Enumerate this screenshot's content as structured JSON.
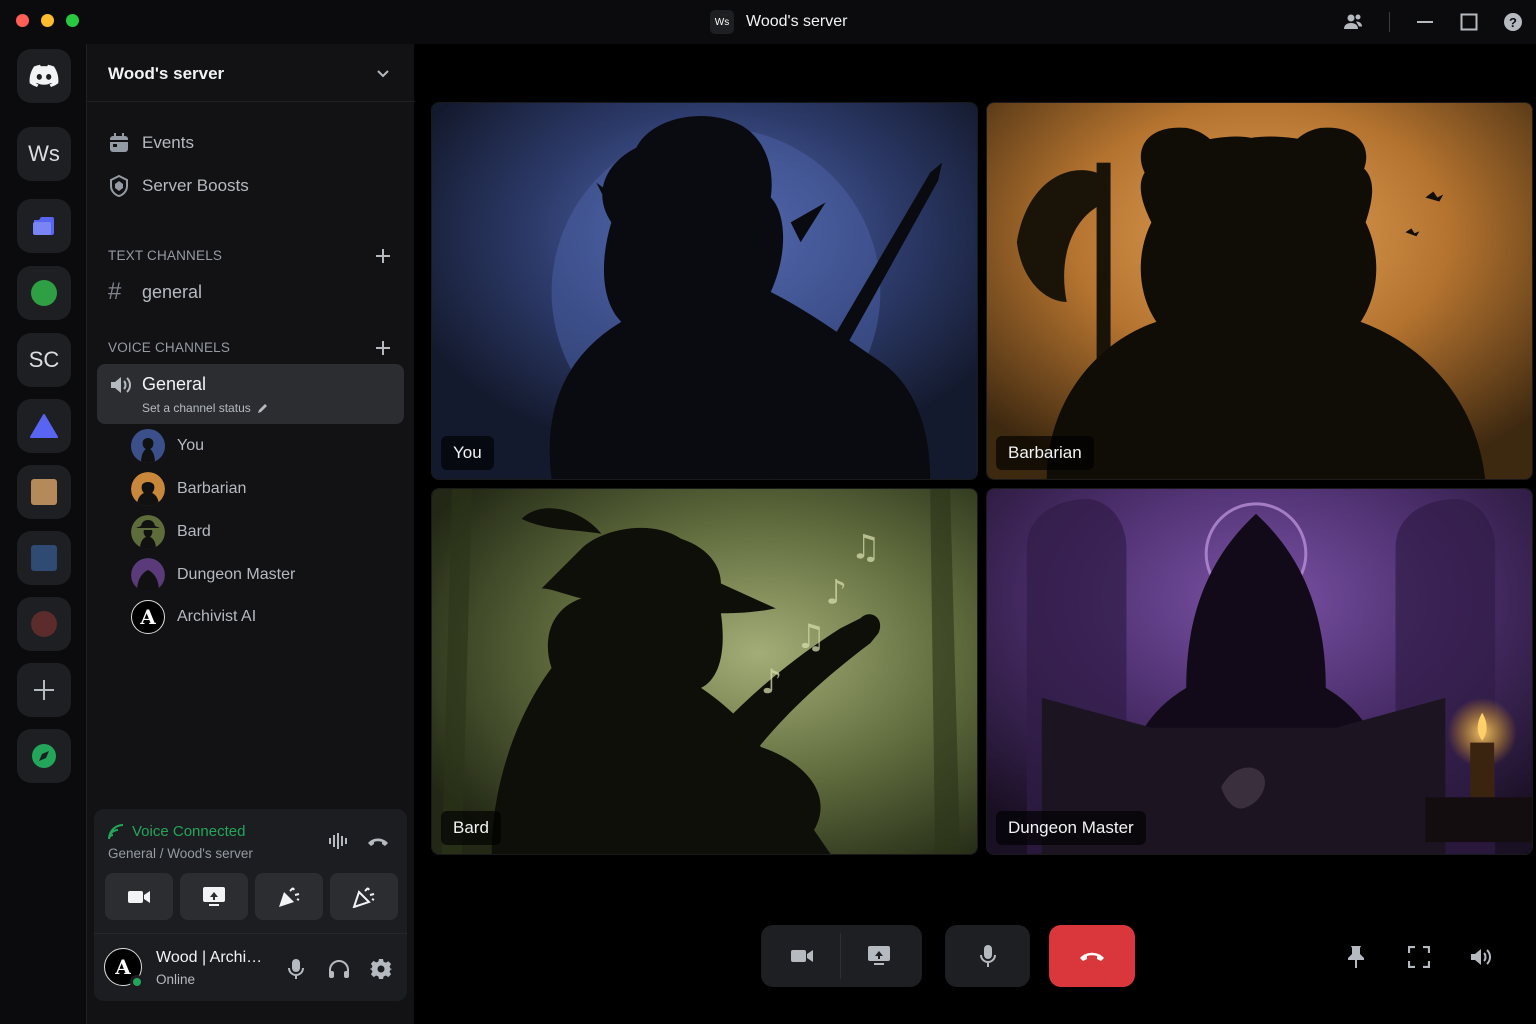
{
  "window": {
    "title": "Wood's server",
    "badge": "Ws"
  },
  "rail": {
    "servers": [
      {
        "kind": "home",
        "icon": "discord-logo-icon"
      },
      {
        "kind": "text",
        "label": "Ws"
      },
      {
        "kind": "color",
        "color": "#5865f2",
        "icon": "folder-icon"
      },
      {
        "kind": "color",
        "color": "#2ea043"
      },
      {
        "kind": "text",
        "label": "SC"
      },
      {
        "kind": "color",
        "color": "#5865f2",
        "icon": "triangle-icon"
      },
      {
        "kind": "color",
        "color": "#b58a5a"
      },
      {
        "kind": "color",
        "color": "#2f4a73"
      },
      {
        "kind": "color",
        "color": "#5c2b2b"
      },
      {
        "kind": "action",
        "icon": "add-server-icon"
      },
      {
        "kind": "action",
        "icon": "discover-compass-icon",
        "color": "#23a55a"
      }
    ]
  },
  "sidebar": {
    "server_name": "Wood's server",
    "menu": [
      {
        "label": "Events",
        "icon": "calendar-icon"
      },
      {
        "label": "Server Boosts",
        "icon": "boost-shield-icon"
      }
    ],
    "text_section": "TEXT CHANNELS",
    "text_channels": [
      {
        "label": "general"
      }
    ],
    "voice_section": "VOICE CHANNELS",
    "voice_channel": {
      "name": "General",
      "status_placeholder": "Set a channel status"
    },
    "members": [
      {
        "name": "You",
        "color": "#3b4f8a"
      },
      {
        "name": "Barbarian",
        "color": "#c9873c"
      },
      {
        "name": "Bard",
        "color": "#5e6b3a"
      },
      {
        "name": "Dungeon Master",
        "color": "#5a3a78"
      },
      {
        "name": "Archivist AI",
        "color": "#000000"
      }
    ]
  },
  "voice_panel": {
    "status": "Voice Connected",
    "location": "General /  Wood's server"
  },
  "user": {
    "name": "Wood | Archivist",
    "status": "Online",
    "status_color": "#23a55a",
    "avatar_glyph": "A"
  },
  "tiles": [
    {
      "label": "You",
      "theme": "blue"
    },
    {
      "label": "Barbarian",
      "theme": "amber"
    },
    {
      "label": "Bard",
      "theme": "green"
    },
    {
      "label": "Dungeon Master",
      "theme": "purple"
    }
  ],
  "colors": {
    "accent_green": "#23a55a",
    "hangup_red": "#da373c",
    "blurple": "#5865f2"
  }
}
